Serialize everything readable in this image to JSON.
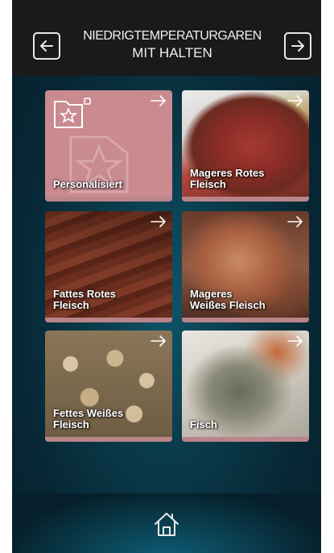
{
  "header": {
    "title_line1": "NIEDRIGTEMPERATURGAREN",
    "title_line2": "MIT HALTEN",
    "back_icon": "arrow-left-icon",
    "forward_icon": "arrow-right-icon"
  },
  "tiles": [
    {
      "line1": "Personalisiert",
      "line2": ""
    },
    {
      "line1": "Mageres Rotes",
      "line2": "Fleisch"
    },
    {
      "line1": "Fattes Rotes",
      "line2": "Fleisch"
    },
    {
      "line1": "Mageres",
      "line2": "Weißes Fleisch"
    },
    {
      "line1": "Fettes Weißes",
      "line2": "Fleisch"
    },
    {
      "line1": "Fisch",
      "line2": ""
    }
  ],
  "footer": {
    "home_icon": "home-icon"
  },
  "colors": {
    "header_bg": "#1a1a1a",
    "tile_bar": "#b9858a",
    "personalized_tile": "#c98a90",
    "screen_bg": "#0a3a4a"
  }
}
